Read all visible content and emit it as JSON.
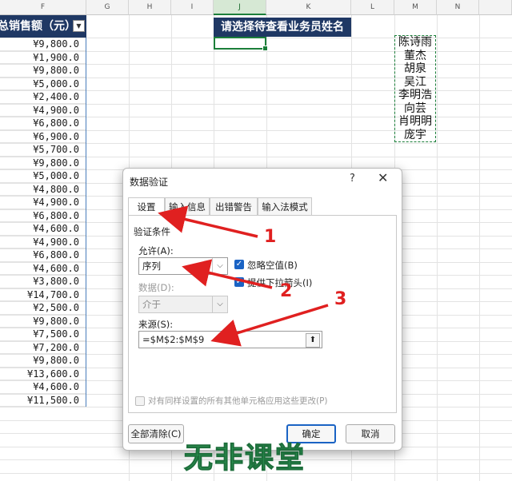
{
  "columns": [
    "F",
    "G",
    "H",
    "I",
    "J",
    "K",
    "L",
    "M",
    "N"
  ],
  "sheet": {
    "header_f": "总销售额（元）",
    "sales_values": [
      "¥9,800.0",
      "¥1,900.0",
      "¥9,800.0",
      "¥5,000.0",
      "¥2,400.0",
      "¥4,900.0",
      "¥6,800.0",
      "¥6,900.0",
      "¥5,700.0",
      "¥9,800.0",
      "¥5,000.0",
      "¥4,800.0",
      "¥4,900.0",
      "¥6,800.0",
      "¥4,600.0",
      "¥4,900.0",
      "¥6,800.0",
      "¥4,600.0",
      "¥3,800.0",
      "¥14,700.0",
      "¥2,500.0",
      "¥9,800.0",
      "¥7,500.0",
      "¥7,200.0",
      "¥9,800.0",
      "¥13,600.0",
      "¥4,600.0",
      "¥11,500.0"
    ],
    "prompt": "请选择待查看业务员姓名",
    "names": [
      "陈诗雨",
      "董杰",
      "胡泉",
      "吴江",
      "李明浩",
      "向芸",
      "肖明明",
      "庞宇"
    ]
  },
  "dialog": {
    "title": "数据验证",
    "help": "?",
    "close": "✕",
    "tabs": [
      "设置",
      "输入信息",
      "出错警告",
      "输入法模式"
    ],
    "group_label": "验证条件",
    "allow_label": "允许(A):",
    "allow_value": "序列",
    "ignore_blank": "忽略空值(B)",
    "dropdown": "提供下拉箭头(I)",
    "data_label": "数据(D):",
    "data_value": "介于",
    "source_label": "来源(S):",
    "source_value": "=$M$2:$M$9",
    "apply_all": "对有同样设置的所有其他单元格应用这些更改(P)",
    "clear_all": "全部清除(C)",
    "ok": "确定",
    "cancel": "取消"
  },
  "annotations": [
    "1",
    "2",
    "3"
  ],
  "watermark": "无非课堂",
  "colors": {
    "header_bg": "#1f3864",
    "accent": "#1a63c4",
    "arrow": "#e02020",
    "selection": "#1b7f3a"
  }
}
